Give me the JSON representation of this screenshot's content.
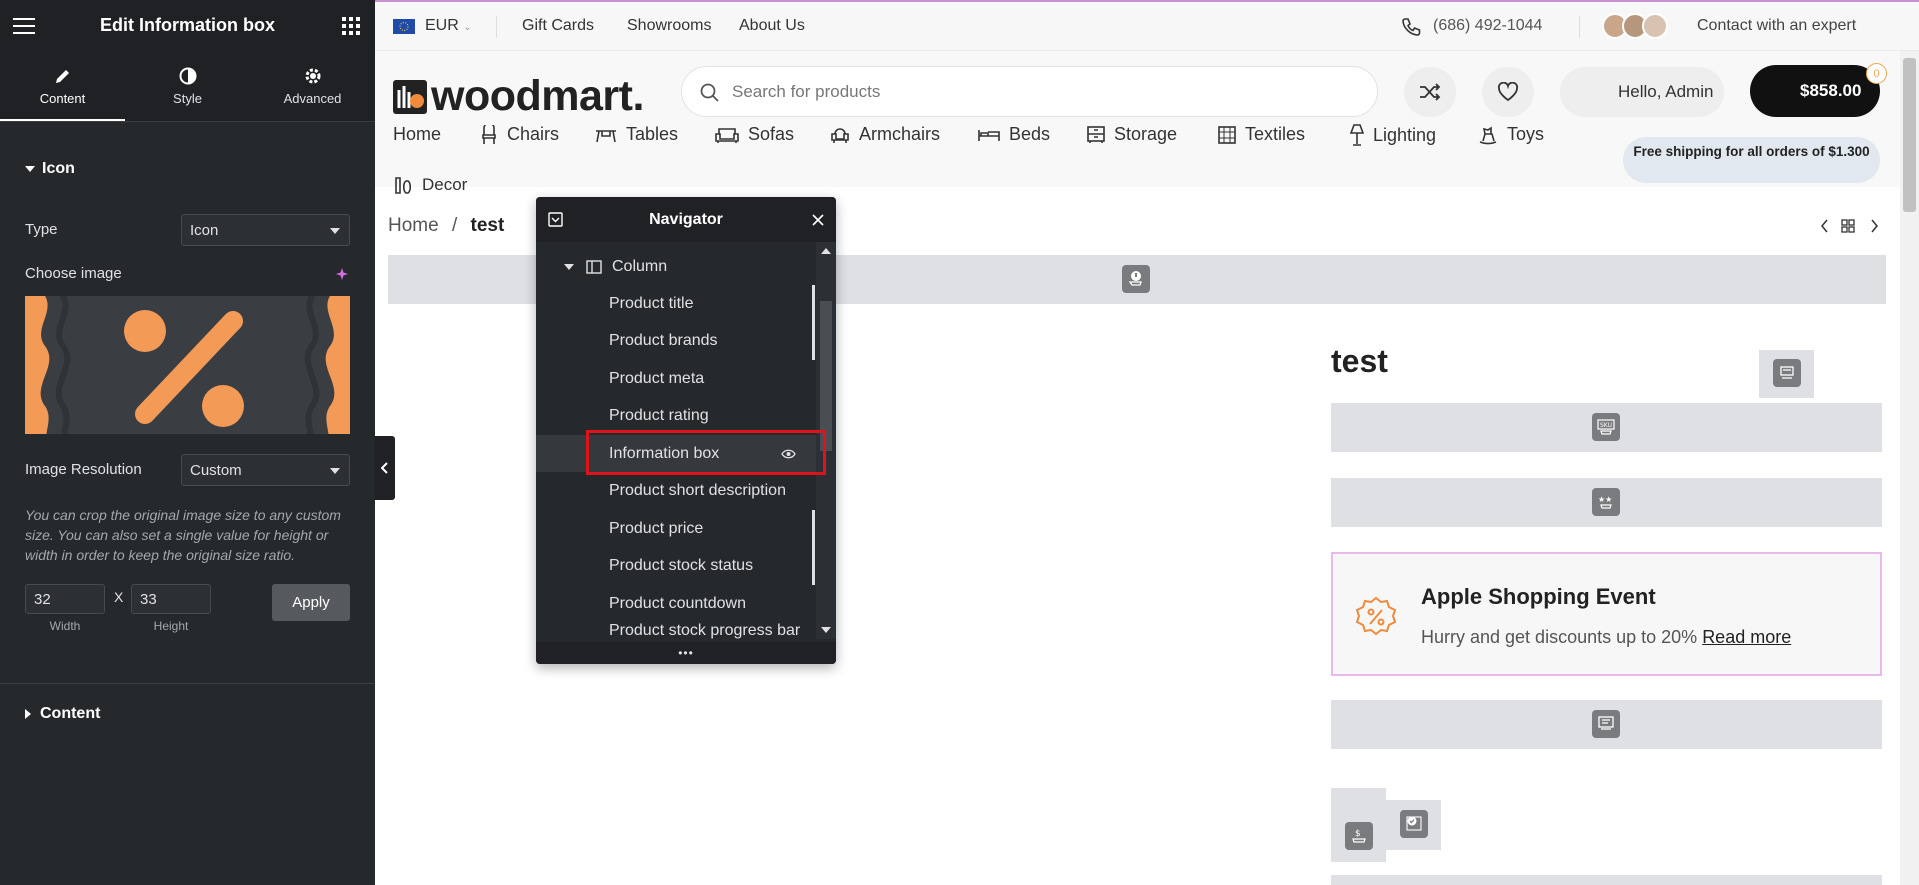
{
  "editor": {
    "title": "Edit Information box",
    "tabs": [
      {
        "label": "Content"
      },
      {
        "label": "Style"
      },
      {
        "label": "Advanced"
      }
    ],
    "section_icon": "Icon",
    "type_label": "Type",
    "type_value": "Icon",
    "choose_image_label": "Choose image",
    "resolution_label": "Image Resolution",
    "resolution_value": "Custom",
    "resolution_hint": "You can crop the original image size to any custom size. You can also set a single value for height or width in order to keep the original size ratio.",
    "width_value": "32",
    "height_value": "33",
    "x_sep": "X",
    "width_label": "Width",
    "height_label": "Height",
    "apply_label": "Apply",
    "section_content": "Content",
    "preview_colors": {
      "bg": "#3a3e43",
      "accent": "#f39a57"
    }
  },
  "topbar": {
    "currency": "EUR",
    "links": [
      "Gift Cards",
      "Showrooms",
      "About Us"
    ],
    "phone": "(686) 492-1044",
    "contact": "Contact with an expert"
  },
  "header": {
    "logo": "woodmart.",
    "search_placeholder": "Search for products",
    "account": "Hello, Admin",
    "cart_total": "$858.00",
    "cart_count": "0",
    "shipping_note": "Free shipping for all orders of $1.300",
    "nav": [
      "Home",
      "Chairs",
      "Tables",
      "Sofas",
      "Armchairs",
      "Beds",
      "Storage",
      "Textiles",
      "Lighting",
      "Toys",
      "Decor"
    ]
  },
  "breadcrumb": {
    "home": "Home",
    "sep": "/",
    "current": "test"
  },
  "product": {
    "title": "test",
    "info_box": {
      "title": "Apple Shopping Event",
      "text": "Hurry and get discounts up to 20%",
      "link": "Read more"
    }
  },
  "navigator": {
    "title": "Navigator",
    "column_label": "Column",
    "items": [
      "Product title",
      "Product brands",
      "Product meta",
      "Product rating",
      "Information box",
      "Product short description",
      "Product price",
      "Product stock status",
      "Product countdown",
      "Product stock progress bar"
    ],
    "selected_index": 4
  },
  "colors": {
    "accent": "#f08a3c",
    "highlight": "#e0121c",
    "editor_bg": "#26292c"
  }
}
